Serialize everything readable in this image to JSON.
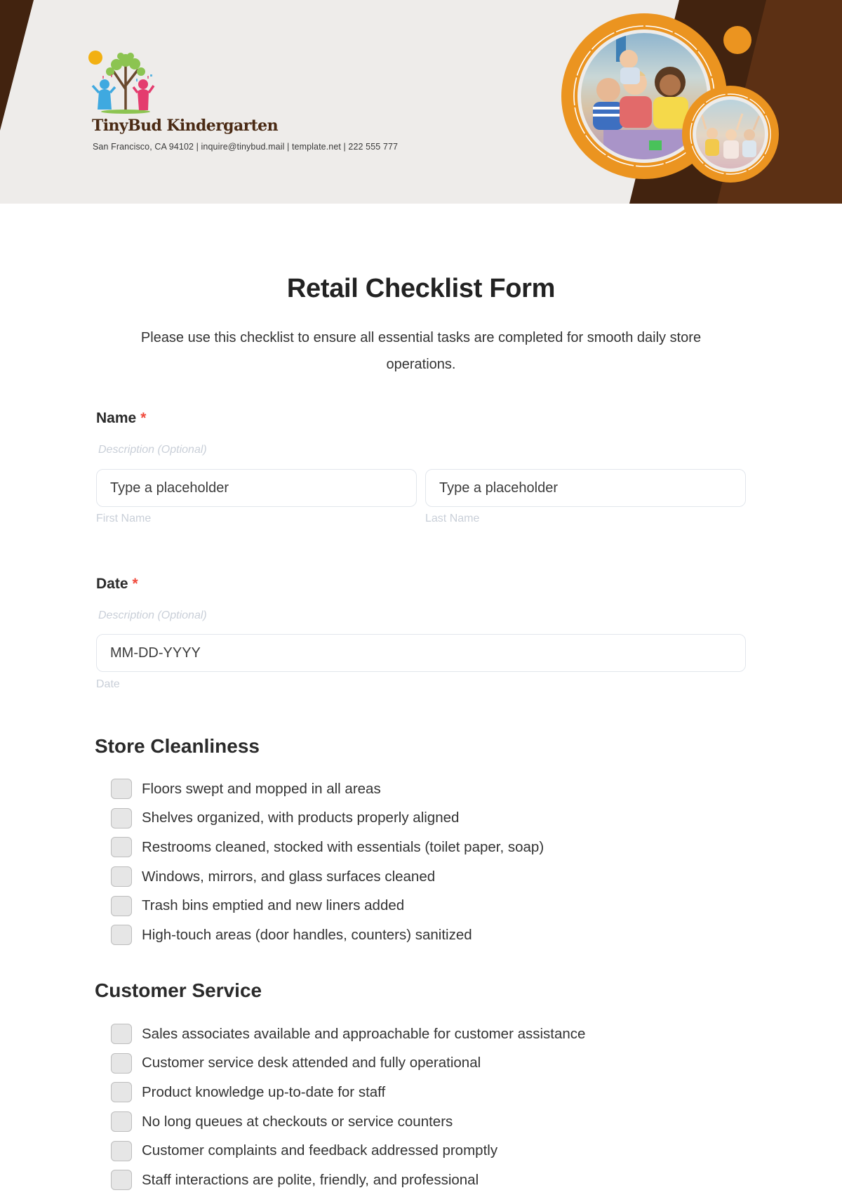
{
  "header": {
    "brand_name": "TinyBud Kindergarten",
    "contact_line": "San Francisco, CA 94102 | inquire@tinybud.mail | template.net | 222 555 777",
    "colors": {
      "band": "#EEECEA",
      "dark_brown": "#42230F",
      "mid_brown": "#5C3014",
      "orange": "#EB9420"
    },
    "images": [
      "children-in-classroom-photo",
      "children-raising-hands-photo"
    ]
  },
  "form": {
    "title": "Retail Checklist Form",
    "intro": "Please use this checklist to ensure all essential tasks are completed for smooth daily store operations.",
    "required_marker": "*",
    "name_field": {
      "label": "Name",
      "description": "Description (Optional)",
      "first": {
        "placeholder": "Type a placeholder",
        "sublabel": "First Name"
      },
      "last": {
        "placeholder": "Type a placeholder",
        "sublabel": "Last Name"
      }
    },
    "date_field": {
      "label": "Date",
      "description": "Description (Optional)",
      "placeholder": "MM-DD-YYYY",
      "sublabel": "Date"
    },
    "sections": [
      {
        "title": "Store Cleanliness",
        "items": [
          {
            "label": "Floors swept and mopped in all areas",
            "checked": false
          },
          {
            "label": "Shelves organized, with products properly aligned",
            "checked": false
          },
          {
            "label": "Restrooms cleaned, stocked with essentials (toilet paper, soap)",
            "checked": false
          },
          {
            "label": "Windows, mirrors, and glass surfaces cleaned",
            "checked": false
          },
          {
            "label": "Trash bins emptied and new liners added",
            "checked": false
          },
          {
            "label": "High-touch areas (door handles, counters) sanitized",
            "checked": false
          }
        ]
      },
      {
        "title": "Customer Service",
        "items": [
          {
            "label": "Sales associates available and approachable for customer assistance",
            "checked": false
          },
          {
            "label": "Customer service desk attended and fully operational",
            "checked": false
          },
          {
            "label": "Product knowledge up-to-date for staff",
            "checked": false
          },
          {
            "label": "No long queues at checkouts or service counters",
            "checked": false
          },
          {
            "label": "Customer complaints and feedback addressed promptly",
            "checked": false
          },
          {
            "label": "Staff interactions are polite, friendly, and professional",
            "checked": false
          }
        ]
      }
    ]
  }
}
